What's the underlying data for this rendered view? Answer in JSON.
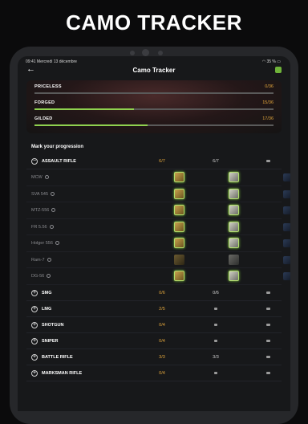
{
  "headline": "CAMO TRACKER",
  "status_bar": {
    "time": "09:41",
    "date": "Mercredi 13 décembre",
    "battery": "35 %"
  },
  "nav": {
    "title": "Camo Tracker",
    "back_icon": "arrow-left-icon",
    "settings_icon": "gear-icon"
  },
  "progress": [
    {
      "label": "PRICELESS",
      "value": "0/36",
      "fraction": 0.0
    },
    {
      "label": "FORGED",
      "value": "15/36",
      "fraction": 0.4167
    },
    {
      "label": "GILDED",
      "value": "17/36",
      "fraction": 0.4722
    }
  ],
  "section_title": "Mark your progression",
  "expanded_category": {
    "label": "ASSAULT RIFLE",
    "col1": "6/7",
    "col2": "6/7",
    "weapons": [
      {
        "name": "MCW",
        "gold": true,
        "plat": true
      },
      {
        "name": "SVA 545",
        "gold": true,
        "plat": true
      },
      {
        "name": "MTZ-556",
        "gold": true,
        "plat": true
      },
      {
        "name": "FR 5.56",
        "gold": true,
        "plat": true
      },
      {
        "name": "Holger 556",
        "gold": true,
        "plat": true
      },
      {
        "name": "Ram-7",
        "gold": false,
        "plat": false
      },
      {
        "name": "DG-56",
        "gold": true,
        "plat": true
      }
    ]
  },
  "categories": [
    {
      "label": "SMG",
      "col1": "0/6",
      "col2": "0/6"
    },
    {
      "label": "LMG",
      "col1": "2/5",
      "col2": ""
    },
    {
      "label": "SHOTGUN",
      "col1": "0/4",
      "col2": ""
    },
    {
      "label": "SNIPER",
      "col1": "0/4",
      "col2": ""
    },
    {
      "label": "BATTLE RIFLE",
      "col1": "3/3",
      "col2": "3/3"
    },
    {
      "label": "MARKSMAN RIFLE",
      "col1": "0/4",
      "col2": ""
    }
  ],
  "colors": {
    "accent_green": "#8fd14f",
    "accent_orange": "#e2a63c",
    "background": "#17181a"
  }
}
